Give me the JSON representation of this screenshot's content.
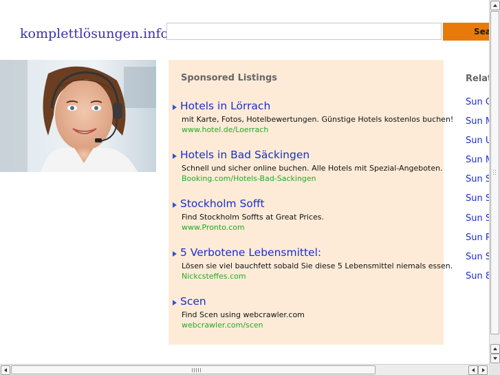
{
  "header": {
    "logo_text": "komplettlösungen.info",
    "search_value": "",
    "search_button_label": "Sea"
  },
  "sponsored": {
    "title": "Sponsored Listings",
    "listings": [
      {
        "title": "Hotels in Lörrach",
        "description": "mit Karte, Fotos, Hotelbewertungen. Günstige Hotels kostenlos buchen!",
        "url": "www.hotel.de/Loerrach"
      },
      {
        "title": "Hotels in Bad Säckingen",
        "description": "Schnell und sicher online buchen. Alle Hotels mit Spezial-Angeboten.",
        "url": "Booking.com/Hotels-Bad-Sackingen"
      },
      {
        "title": "Stockholm Sofft",
        "description": "Find Stockholm Soffts at Great Prices.",
        "url": "www.Pronto.com"
      },
      {
        "title": "5 Verbotene Lebensmittel:",
        "description": "Lösen sie viel bauchfett sobald Sie diese 5 Lebensmittel niemals essen.",
        "url": "Nickcsteffes.com"
      },
      {
        "title": "Scen",
        "description": "Find Scen using webcrawler.com",
        "url": "webcrawler.com/scen"
      }
    ]
  },
  "related": {
    "title": "Relate",
    "items": [
      "Sun C",
      "Sun M",
      "Sun U",
      "Sun M",
      "Sun S",
      "Sun S",
      "Sun S",
      "Sun P",
      "Sun S",
      "Sun 8"
    ]
  },
  "colors": {
    "logo": "#3a2fb0",
    "link": "#1a2ecc",
    "url_green": "#22aa22",
    "search_button": "#e87a0c",
    "sponsored_bg": "#fdebd8"
  }
}
